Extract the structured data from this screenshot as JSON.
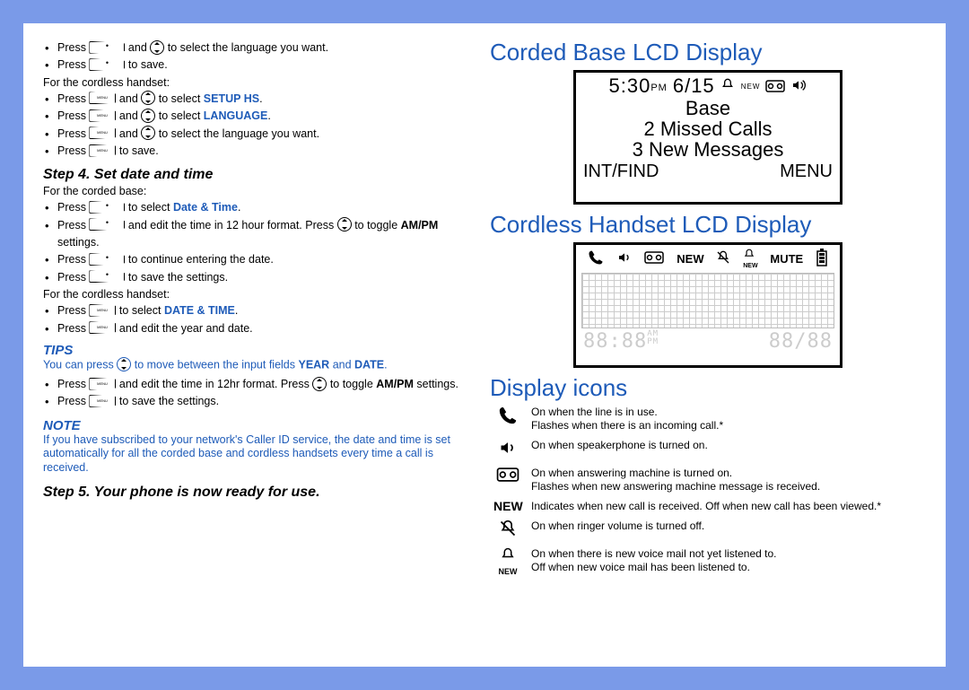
{
  "left": {
    "row1": {
      "press": "Press",
      "and": "and",
      "tail": "to select the language you want."
    },
    "row2": {
      "press": "Press",
      "tail": "to save."
    },
    "sub_cordless": "For the cordless handset:",
    "hs1": {
      "press": "Press",
      "and": "and",
      "tail_a": "to select ",
      "kw": "SETUP HS",
      "tail_b": "."
    },
    "hs2": {
      "press": "Press",
      "and": "and",
      "tail_a": "to select ",
      "kw": "LANGUAGE",
      "tail_b": "."
    },
    "hs3": {
      "press": "Press",
      "and": "and",
      "tail": "to select the language you want."
    },
    "hs4": {
      "press": "Press",
      "tail": "to save."
    },
    "step4": "Step 4. Set date and time",
    "sub_corded": "For the corded base:",
    "cb1": {
      "press": "Press",
      "tail_a": "to select ",
      "kw": "Date & Time",
      "tail_b": "."
    },
    "cb2": {
      "press": "Press",
      "mid_a": "and edit the time in 12 hour format. Press",
      "mid_b": "to toggle ",
      "kw": "AM/PM",
      "tail": " settings."
    },
    "cb3": {
      "press": "Press",
      "tail": "to continue entering the date."
    },
    "cb4": {
      "press": "Press",
      "tail": "to save the settings."
    },
    "sub_cordless2": "For the cordless handset:",
    "ch1": {
      "press": "Press",
      "tail_a": "to select ",
      "kw": "DATE & TIME",
      "tail_b": "."
    },
    "ch2": {
      "press": "Press",
      "tail": "and edit the year and date."
    },
    "tips_h": "TIPS",
    "tips_body_a": "You can press ",
    "tips_body_b": " to move between the input fields ",
    "tips_kw1": "YEAR",
    "tips_and": " and ",
    "tips_kw2": "DATE",
    "tips_body_c": ".",
    "t1": {
      "press": "Press",
      "mid_a": "and edit the time in 12hr format. Press",
      "mid_b": "to toggle ",
      "kw": "AM/PM",
      "tail": " settings."
    },
    "t2": {
      "press": "Press",
      "tail": "to save the settings."
    },
    "note_h": "NOTE",
    "note_body": "If you have subscribed to your network's Caller ID service, the date and time is set automatically for all the corded base and cordless handsets every time a call is received.",
    "step5": "Step 5. Your phone is now ready for use."
  },
  "right": {
    "h1": "Corded Base LCD Display",
    "lcd1": {
      "time": "5:30",
      "pm": "PM",
      "date": "6/15",
      "new": "NEW",
      "base": "Base",
      "missed": "2 Missed Calls",
      "msgs": "3 New Messages",
      "bl": "INT/FIND",
      "br": "MENU"
    },
    "h2": "Cordless Handset LCD Display",
    "lcd2": {
      "new": "NEW",
      "mute": "MUTE",
      "seg1": "88:88",
      "am": "AM",
      "pm": "PM",
      "seg2": "88/88"
    },
    "h3": "Display icons",
    "icons": [
      {
        "label": "handset-icon",
        "text": "On when the line is in use.\nFlashes when there is an incoming call.*"
      },
      {
        "label": "speaker-icon",
        "text": "On when speakerphone is turned on."
      },
      {
        "label": "tape-icon",
        "text": "On when answering machine is turned on.\nFlashes when new answering machine message is received."
      },
      {
        "label": "new-text-icon",
        "word": "NEW",
        "text": "Indicates when new call is received. Off when new call has been viewed.*"
      },
      {
        "label": "bell-off-icon",
        "text": "On when ringer volume is turned off."
      },
      {
        "label": "bell-new-icon",
        "word": "NEW",
        "text": "On when there is new voice mail not yet listened to.\nOff when new voice mail has been listened to."
      }
    ]
  }
}
